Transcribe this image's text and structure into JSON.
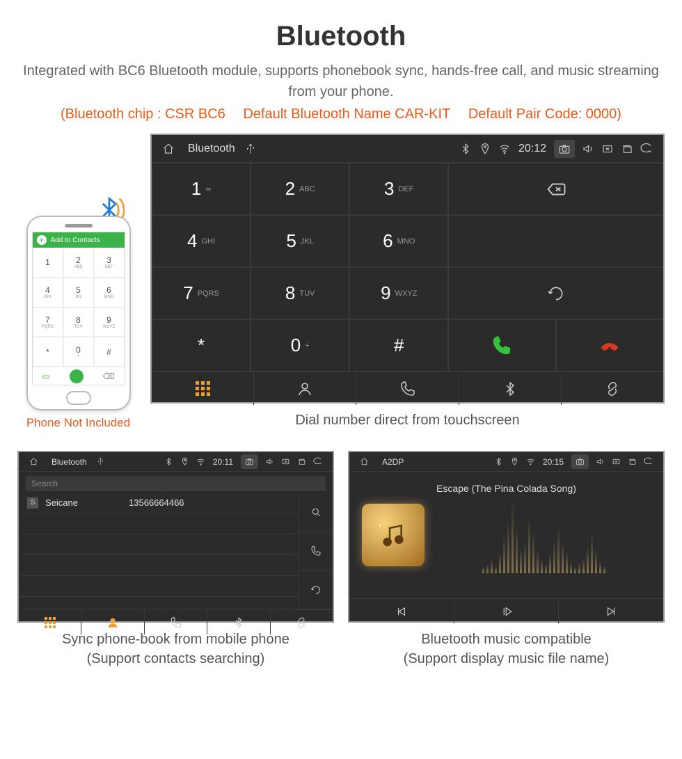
{
  "header": {
    "title": "Bluetooth",
    "subtitle": "Integrated with BC6 Bluetooth module, supports phonebook sync, hands-free call, and music streaming from your phone.",
    "spec_chip": "(Bluetooth chip : CSR BC6",
    "spec_name": "Default Bluetooth Name CAR-KIT",
    "spec_code": "Default Pair Code: 0000)"
  },
  "phone": {
    "topbar_label": "Add to Contacts",
    "keys": [
      {
        "n": "1",
        "l": ""
      },
      {
        "n": "2",
        "l": "ABC"
      },
      {
        "n": "3",
        "l": "DEF"
      },
      {
        "n": "4",
        "l": "GHI"
      },
      {
        "n": "5",
        "l": "JKL"
      },
      {
        "n": "6",
        "l": "MNO"
      },
      {
        "n": "7",
        "l": "PQRS"
      },
      {
        "n": "8",
        "l": "TUV"
      },
      {
        "n": "9",
        "l": "WXYZ"
      },
      {
        "n": "*",
        "l": ""
      },
      {
        "n": "0",
        "l": "+"
      },
      {
        "n": "#",
        "l": ""
      }
    ],
    "not_included": "Phone Not Included"
  },
  "dialer": {
    "status": {
      "title": "Bluetooth",
      "time": "20:12"
    },
    "keys": [
      {
        "n": "1",
        "l": "∞"
      },
      {
        "n": "2",
        "l": "ABC"
      },
      {
        "n": "3",
        "l": "DEF"
      },
      {
        "n": "4",
        "l": "GHI"
      },
      {
        "n": "5",
        "l": "JKL"
      },
      {
        "n": "6",
        "l": "MNO"
      },
      {
        "n": "7",
        "l": "PQRS"
      },
      {
        "n": "8",
        "l": "TUV"
      },
      {
        "n": "9",
        "l": "WXYZ"
      },
      {
        "n": "*",
        "l": ""
      },
      {
        "n": "0",
        "l": "+"
      },
      {
        "n": "#",
        "l": ""
      }
    ],
    "caption": "Dial number direct from touchscreen"
  },
  "phonebook": {
    "status": {
      "title": "Bluetooth",
      "time": "20:11"
    },
    "search_placeholder": "Search",
    "contacts": [
      {
        "tag": "S",
        "name": "Seicane",
        "number": "13566664466"
      }
    ],
    "caption_l1": "Sync phone-book from mobile phone",
    "caption_l2": "(Support contacts searching)"
  },
  "a2dp": {
    "status": {
      "title": "A2DP",
      "time": "20:15"
    },
    "song": "Escape (The Pina Colada Song)",
    "caption_l1": "Bluetooth music compatible",
    "caption_l2": "(Support display music file name)"
  }
}
